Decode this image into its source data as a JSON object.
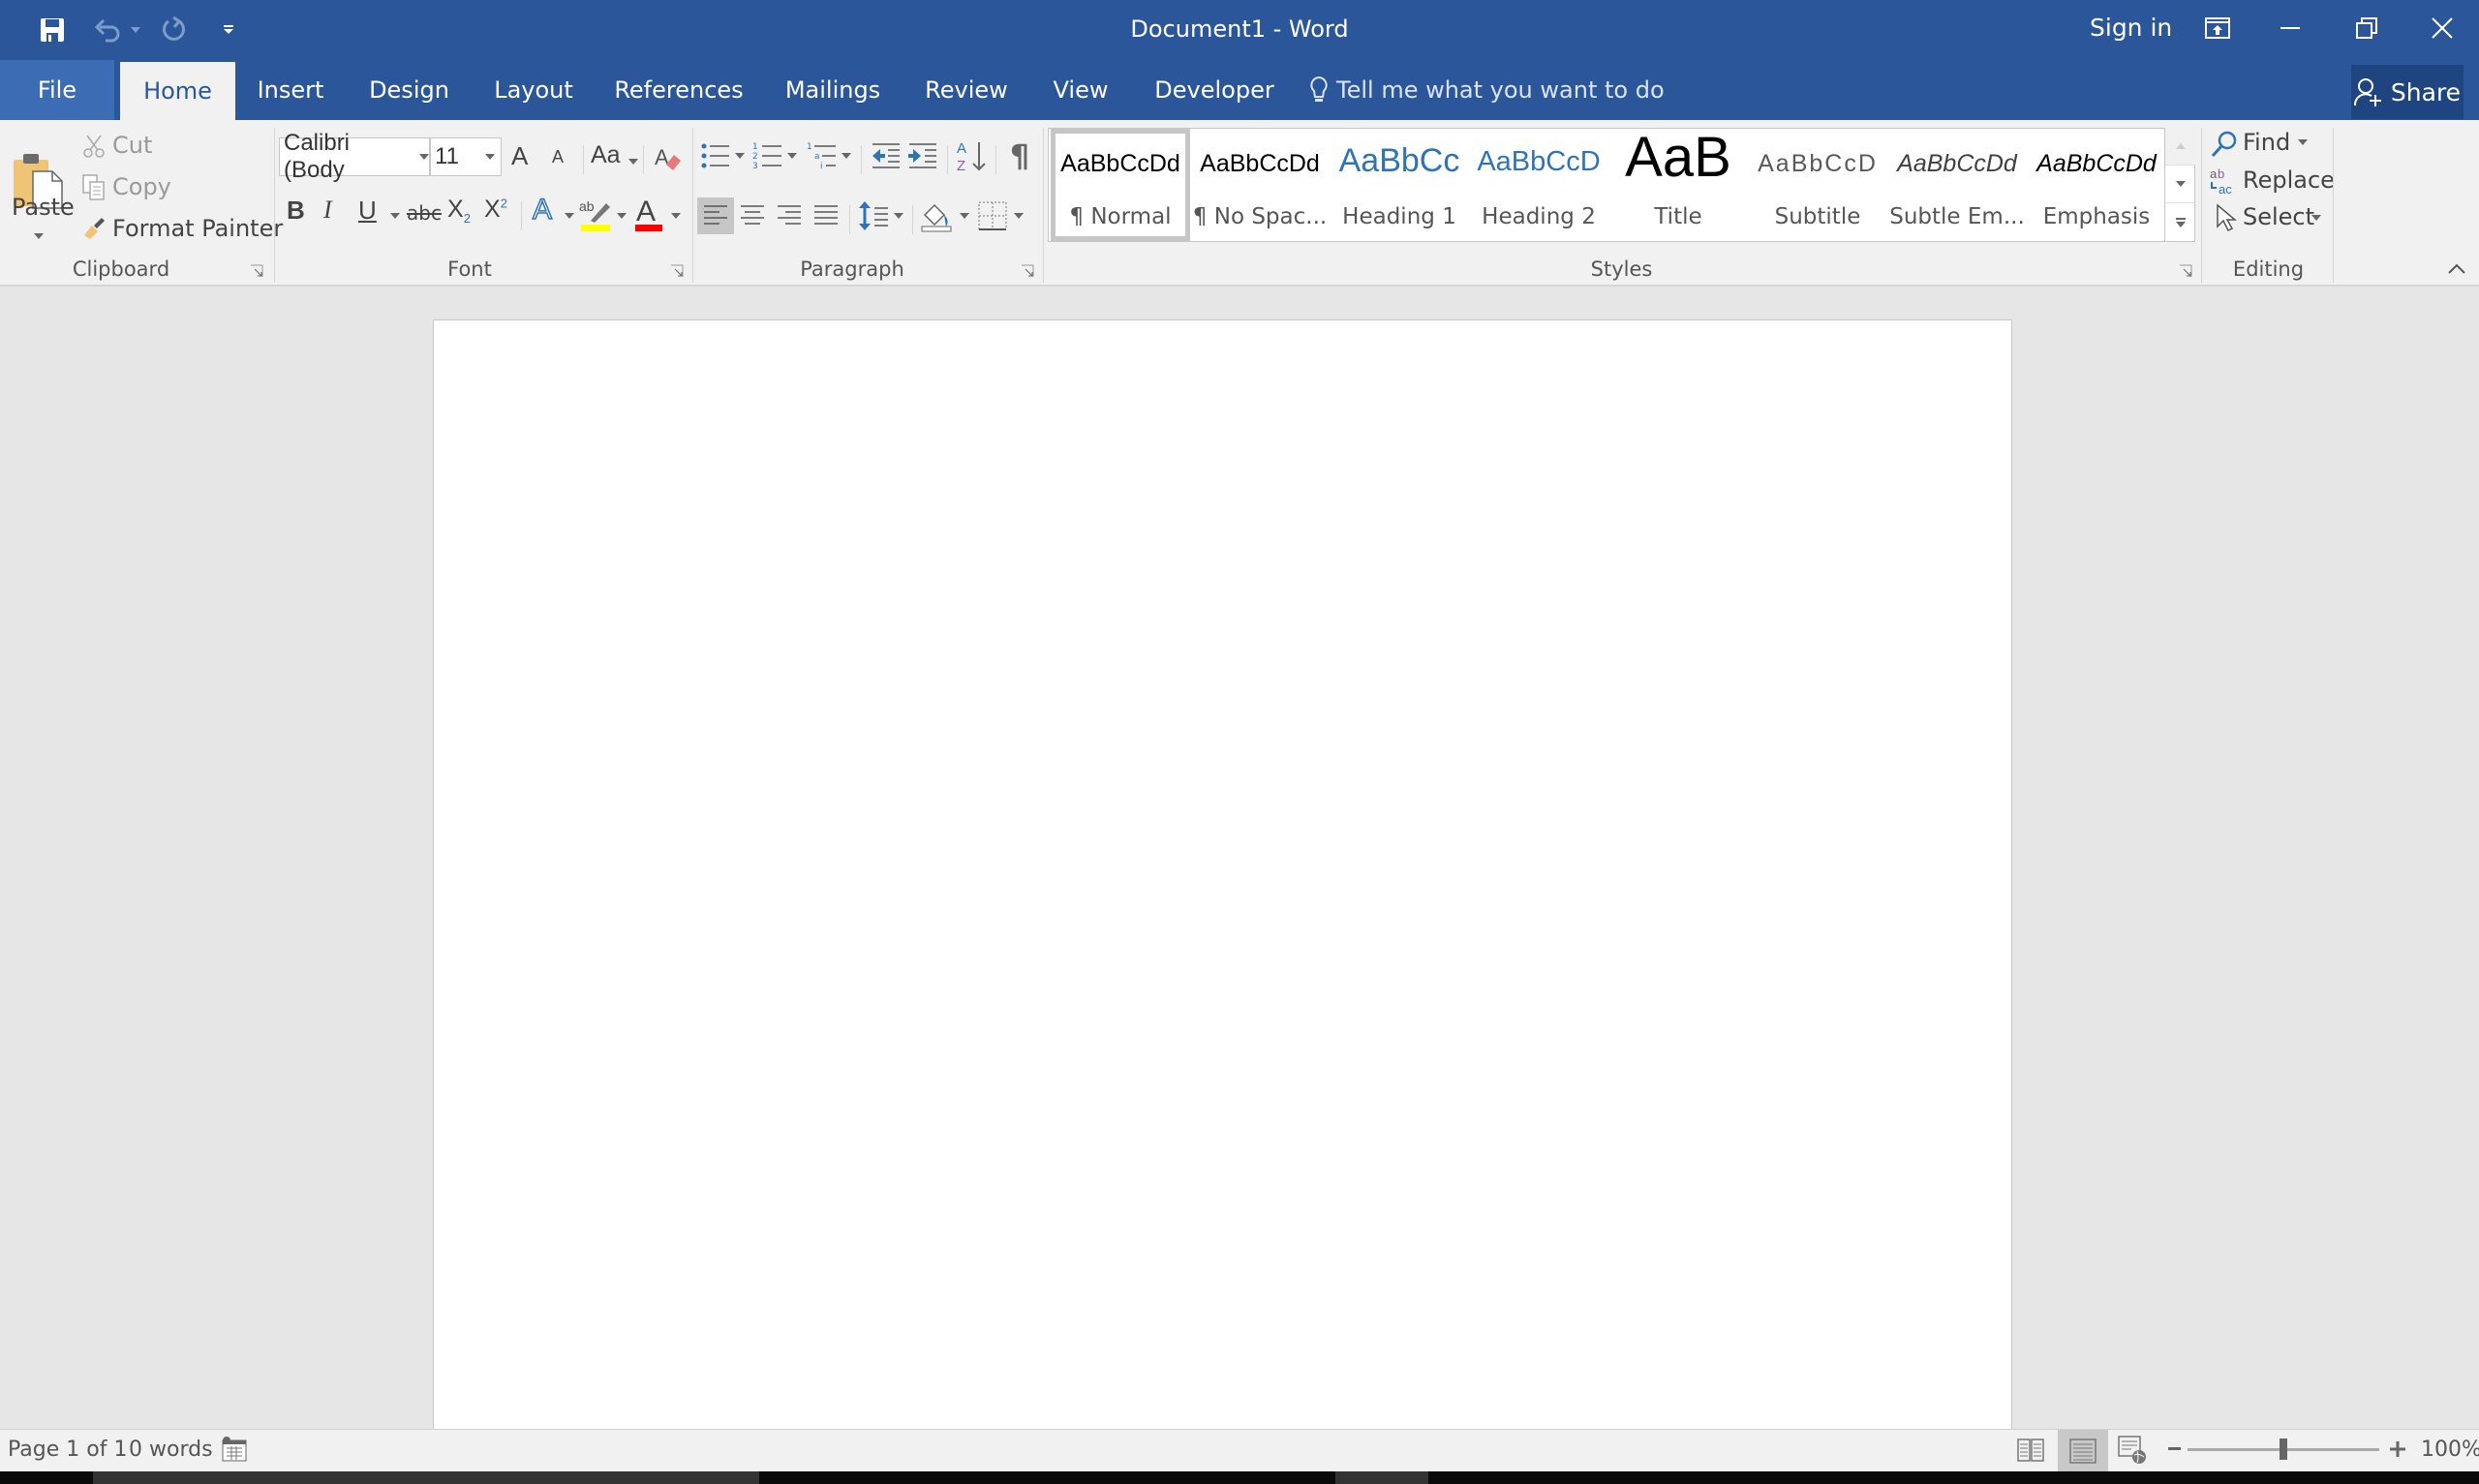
{
  "app": {
    "title": "Document1 - Word",
    "sign_in": "Sign in",
    "share": "Share",
    "tell_me_placeholder": "Tell me what you want to do"
  },
  "quick_access": {
    "icons": [
      "save-icon",
      "undo-icon",
      "redo-icon",
      "customize-quick-access-icon"
    ]
  },
  "window_controls": [
    "ribbon-display-options-icon",
    "minimize-icon",
    "restore-icon",
    "close-icon"
  ],
  "tabs": [
    {
      "label": "File"
    },
    {
      "label": "Home",
      "active": true
    },
    {
      "label": "Insert"
    },
    {
      "label": "Design"
    },
    {
      "label": "Layout"
    },
    {
      "label": "References"
    },
    {
      "label": "Mailings"
    },
    {
      "label": "Review"
    },
    {
      "label": "View"
    },
    {
      "label": "Developer"
    }
  ],
  "ribbon": {
    "clipboard": {
      "label": "Clipboard",
      "paste": "Paste",
      "cut": "Cut",
      "copy": "Copy",
      "format_painter": "Format Painter"
    },
    "font": {
      "label": "Font",
      "font_name": "Calibri (Body",
      "font_size": "11",
      "change_case": "Aa",
      "bold": "B",
      "italic": "I",
      "underline": "U",
      "strikethrough": "abc",
      "subscript": "X",
      "subscript_mark": "2",
      "superscript": "X",
      "superscript_mark": "2",
      "grow": "A",
      "shrink": "A",
      "text_effects": "A",
      "font_color": "A",
      "highlight_color": "#ffff00",
      "font_color_value": "#ff0000"
    },
    "paragraph": {
      "label": "Paragraph"
    },
    "styles": {
      "label": "Styles",
      "items": [
        {
          "preview": "AaBbCcDd",
          "name": "¶ Normal",
          "selected": true
        },
        {
          "preview": "AaBbCcDd",
          "name": "¶ No Spac..."
        },
        {
          "preview": "AaBbCc",
          "name": "Heading 1"
        },
        {
          "preview": "AaBbCcD",
          "name": "Heading 2"
        },
        {
          "preview": "AaB",
          "name": "Title"
        },
        {
          "preview": "AaBbCcD",
          "name": "Subtitle"
        },
        {
          "preview": "AaBbCcDd",
          "name": "Subtle Em..."
        },
        {
          "preview": "AaBbCcDd",
          "name": "Emphasis"
        }
      ]
    },
    "editing": {
      "label": "Editing",
      "find": "Find",
      "replace": "Replace",
      "select": "Select"
    }
  },
  "status": {
    "page": "Page 1 of 1",
    "words": "0 words",
    "zoom": "100%",
    "zoom_fraction": 0.5
  },
  "colors": {
    "accent": "#2b579a",
    "heading": "#2e74b5"
  }
}
